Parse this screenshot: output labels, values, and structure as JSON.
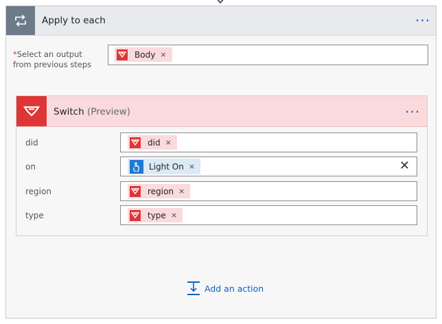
{
  "loop": {
    "title": "Apply to each",
    "more_label": "···",
    "select_required_mark": "*",
    "select_label": "Select an output from previous steps",
    "select_token": {
      "label": "Body",
      "remove": "×"
    }
  },
  "switch": {
    "title": "Switch",
    "subtitle": "(Preview)",
    "more_label": "···",
    "fields": [
      {
        "label": "did",
        "token": "did",
        "remove": "×",
        "token_kind": "red"
      },
      {
        "label": "on",
        "token": "Light On",
        "remove": "×",
        "token_kind": "blue",
        "clear": "✕"
      },
      {
        "label": "region",
        "token": "region",
        "remove": "×",
        "token_kind": "red"
      },
      {
        "label": "type",
        "token": "type",
        "remove": "×",
        "token_kind": "red"
      }
    ]
  },
  "add_action": {
    "label": "Add an action"
  },
  "icons": {
    "loop": "loop-icon",
    "brand": "yeelight-logo-icon",
    "touch": "touch-hand-icon",
    "add_action": "add-action-icon"
  },
  "colors": {
    "accent": "#0b63c5",
    "brand_red": "#e03535",
    "token_red_bg": "#fadadd",
    "token_blue_bg": "#dce9f7",
    "loop_icon_bg": "#6d7a88"
  }
}
